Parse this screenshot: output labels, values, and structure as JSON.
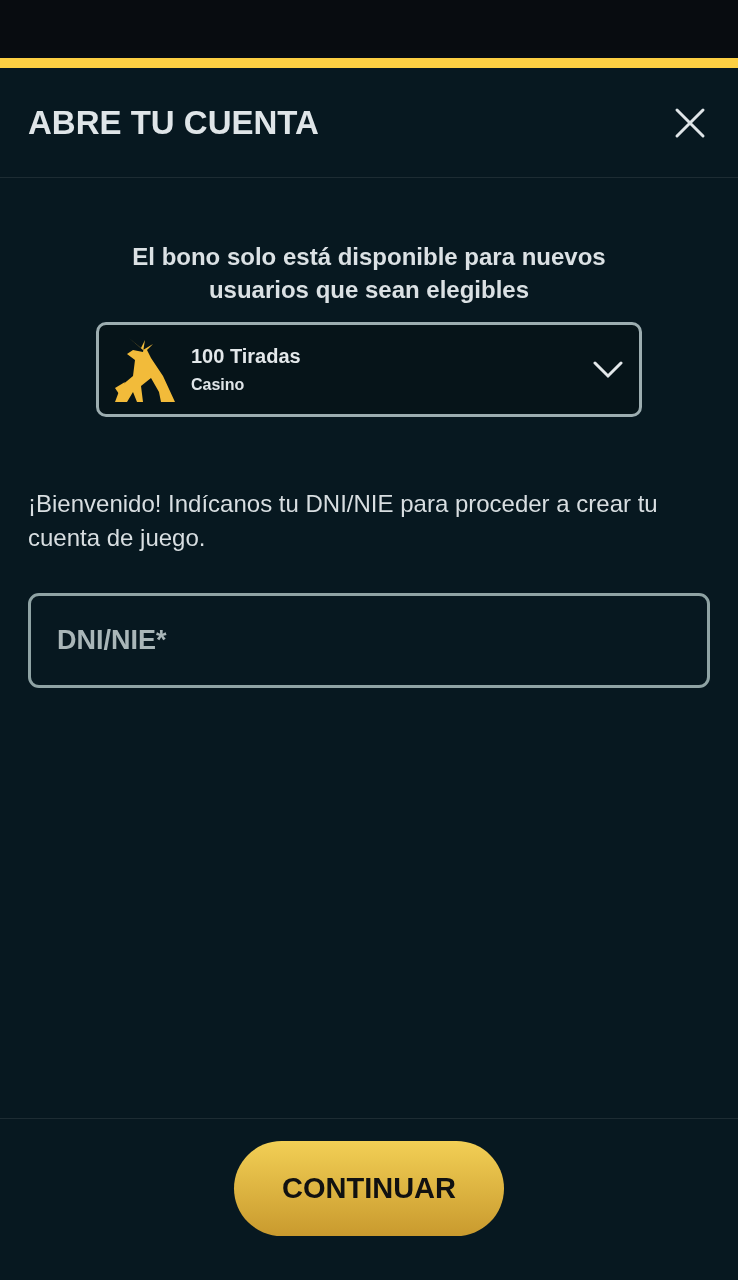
{
  "header": {
    "title": "ABRE TU CUENTA"
  },
  "bonus": {
    "notice": "El bono solo está disponible para nuevos usuarios que sean elegibles",
    "offer_title": "100 Tiradas",
    "offer_category": "Casino",
    "expanded": false
  },
  "intro": "¡Bienvenido! Indícanos tu DNI/NIE para proceder a crear tu cuenta de juego.",
  "id_field": {
    "placeholder": "DNI/NIE*"
  },
  "continue_button": "CONTINUAR"
}
